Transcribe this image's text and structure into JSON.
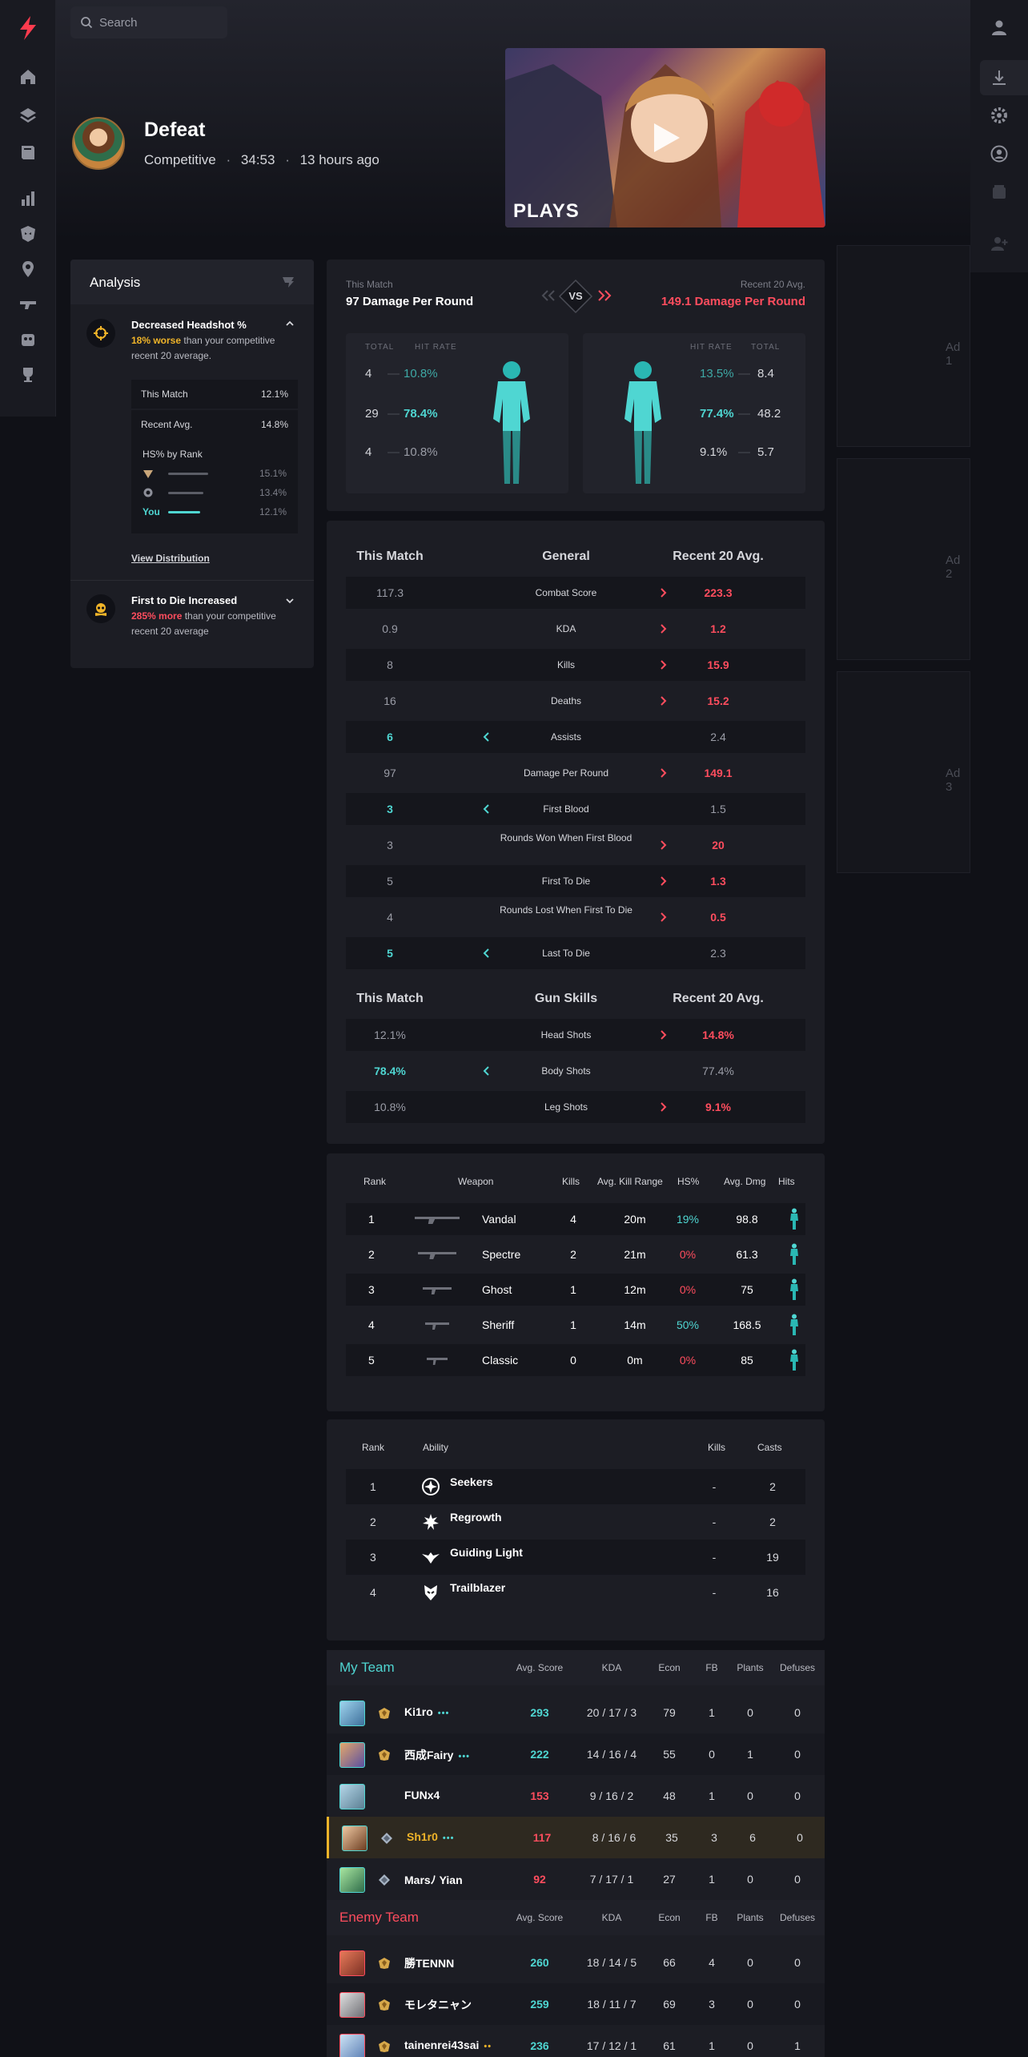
{
  "search": {
    "placeholder": "Search"
  },
  "match": {
    "result": "Defeat",
    "mode": "Competitive",
    "duration": "34:53",
    "time_ago": "13 hours ago",
    "thumb_brand": "PLAYS"
  },
  "analysis": {
    "title": "Analysis",
    "insight1": {
      "title": "Decreased Headshot %",
      "highlight": "18% worse",
      "text": " than your competitive recent 20 average."
    },
    "this_match_label": "This Match",
    "this_match_value": "12.1%",
    "recent_label": "Recent Avg.",
    "recent_value": "14.8%",
    "hs_rank": {
      "title": "HS% by Rank",
      "rows": [
        {
          "label": "",
          "value": "15.1%"
        },
        {
          "label": "",
          "value": "13.4%"
        },
        {
          "label": "You",
          "value": "12.1%"
        }
      ]
    },
    "view_distribution": "View Distribution",
    "insight2": {
      "title": "First to Die Increased",
      "highlight": "285% more",
      "text": " than your competitive recent 20 average"
    }
  },
  "damage": {
    "this_label": "This Match",
    "this_value": "97 Damage Per Round",
    "recent_label": "Recent 20 Avg.",
    "recent_value": "149.1 Damage Per Round",
    "vs": "VS",
    "total_h": "TOTAL",
    "hit_h": "HIT RATE",
    "left": [
      {
        "total": "4",
        "rate": "10.8%"
      },
      {
        "total": "29",
        "rate": "78.4%"
      },
      {
        "total": "4",
        "rate": "10.8%"
      }
    ],
    "right": [
      {
        "total": "8.4",
        "rate": "13.5%"
      },
      {
        "total": "48.2",
        "rate": "77.4%"
      },
      {
        "total": "5.7",
        "rate": "9.1%"
      }
    ]
  },
  "general": {
    "h_this": "This Match",
    "h_mid": "General",
    "h_recent": "Recent 20 Avg.",
    "rows": [
      {
        "this": "117.3",
        "label": "Combat Score",
        "recent": "223.3",
        "better": "recent"
      },
      {
        "this": "0.9",
        "label": "KDA",
        "recent": "1.2",
        "better": "recent"
      },
      {
        "this": "8",
        "label": "Kills",
        "recent": "15.9",
        "better": "recent"
      },
      {
        "this": "16",
        "label": "Deaths",
        "recent": "15.2",
        "better": "recent"
      },
      {
        "this": "6",
        "label": "Assists",
        "recent": "2.4",
        "better": "this"
      },
      {
        "this": "97",
        "label": "Damage Per Round",
        "recent": "149.1",
        "better": "recent"
      },
      {
        "this": "3",
        "label": "First Blood",
        "recent": "1.5",
        "better": "this"
      },
      {
        "this": "3",
        "label": "Rounds Won When First Blood",
        "recent": "20",
        "better": "recent"
      },
      {
        "this": "5",
        "label": "First To Die",
        "recent": "1.3",
        "better": "recent"
      },
      {
        "this": "4",
        "label": "Rounds Lost When First To Die",
        "recent": "0.5",
        "better": "recent"
      },
      {
        "this": "5",
        "label": "Last To Die",
        "recent": "2.3",
        "better": "this"
      }
    ],
    "gun_h_mid": "Gun Skills",
    "gun_rows": [
      {
        "this": "12.1%",
        "label": "Head Shots",
        "recent": "14.8%",
        "better": "recent"
      },
      {
        "this": "78.4%",
        "label": "Body Shots",
        "recent": "77.4%",
        "better": "this"
      },
      {
        "this": "10.8%",
        "label": "Leg Shots",
        "recent": "9.1%",
        "better": "recent"
      }
    ]
  },
  "weapons": {
    "headers": {
      "rank": "Rank",
      "weapon": "Weapon",
      "kills": "Kills",
      "range": "Avg. Kill Range",
      "hs": "HS%",
      "dmg": "Avg. Dmg",
      "hits": "Hits"
    },
    "rows": [
      {
        "rank": "1",
        "name": "Vandal",
        "kills": "4",
        "range": "20m",
        "hs": "19%",
        "dmg": "98.8"
      },
      {
        "rank": "2",
        "name": "Spectre",
        "kills": "2",
        "range": "21m",
        "hs": "0%",
        "dmg": "61.3"
      },
      {
        "rank": "3",
        "name": "Ghost",
        "kills": "1",
        "range": "12m",
        "hs": "0%",
        "dmg": "75"
      },
      {
        "rank": "4",
        "name": "Sheriff",
        "kills": "1",
        "range": "14m",
        "hs": "50%",
        "dmg": "168.5"
      },
      {
        "rank": "5",
        "name": "Classic",
        "kills": "0",
        "range": "0m",
        "hs": "0%",
        "dmg": "85"
      }
    ]
  },
  "abilities": {
    "headers": {
      "rank": "Rank",
      "ability": "Ability",
      "kills": "Kills",
      "casts": "Casts"
    },
    "rows": [
      {
        "rank": "1",
        "name": "Seekers",
        "kills": "-",
        "casts": "2"
      },
      {
        "rank": "2",
        "name": "Regrowth",
        "kills": "-",
        "casts": "2"
      },
      {
        "rank": "3",
        "name": "Guiding Light",
        "kills": "-",
        "casts": "19"
      },
      {
        "rank": "4",
        "name": "Trailblazer",
        "kills": "-",
        "casts": "16"
      }
    ]
  },
  "teams": {
    "headers": {
      "score": "Avg. Score",
      "kda": "KDA",
      "econ": "Econ",
      "fb": "FB",
      "plants": "Plants",
      "defuses": "Defuses"
    },
    "my_team_label": "My Team",
    "enemy_team_label": "Enemy Team",
    "my_team": [
      {
        "name": "Ki1ro",
        "dots": "•••",
        "score": "293",
        "kda": "20 / 17 / 3",
        "econ": "79",
        "fb": "1",
        "plants": "0",
        "defuses": "0"
      },
      {
        "name": "西成Fairy",
        "dots": "•••",
        "score": "222",
        "kda": "14 / 16 / 4",
        "econ": "55",
        "fb": "0",
        "plants": "1",
        "defuses": "0"
      },
      {
        "name": "FUNx4",
        "dots": "",
        "score": "153",
        "kda": "9 / 16 / 2",
        "econ": "48",
        "fb": "1",
        "plants": "0",
        "defuses": "0"
      },
      {
        "name": "Sh1r0",
        "dots": "•••",
        "score": "117",
        "kda": "8 / 16 / 6",
        "econ": "35",
        "fb": "3",
        "plants": "6",
        "defuses": "0"
      },
      {
        "name": "Marsﾉ Yian",
        "dots": "",
        "score": "92",
        "kda": "7 / 17 / 1",
        "econ": "27",
        "fb": "1",
        "plants": "0",
        "defuses": "0"
      }
    ],
    "enemy_team": [
      {
        "name": "勝TENNN",
        "dots": "",
        "score": "260",
        "kda": "18 / 14 / 5",
        "econ": "66",
        "fb": "4",
        "plants": "0",
        "defuses": "0"
      },
      {
        "name": "モレタニャン",
        "dots": "",
        "score": "259",
        "kda": "18 / 11 / 7",
        "econ": "69",
        "fb": "3",
        "plants": "0",
        "defuses": "0"
      },
      {
        "name": "tainenrei43sai",
        "dots": "••",
        "score": "236",
        "kda": "17 / 12 / 1",
        "econ": "61",
        "fb": "1",
        "plants": "0",
        "defuses": "1"
      }
    ]
  },
  "ads": [
    "Ad 1",
    "Ad 2",
    "Ad 3"
  ],
  "colors": {
    "accent_cyan": "#4fd6d2",
    "accent_red": "#ff4d5e",
    "warn_yellow": "#f0b429",
    "bg": "#101117",
    "panel": "#1c1d24"
  }
}
